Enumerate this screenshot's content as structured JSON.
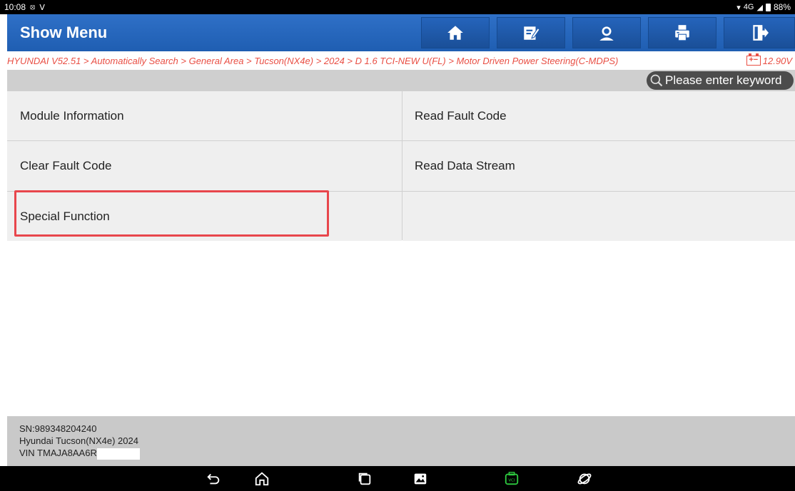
{
  "status_bar": {
    "time": "10:08",
    "battery_percent": "88%",
    "network": "4G"
  },
  "header": {
    "title": "Show Menu",
    "buttons": [
      "home-icon",
      "edit-report-icon",
      "user-icon",
      "print-icon",
      "exit-icon"
    ]
  },
  "breadcrumb": {
    "path": "HYUNDAI V52.51 > Automatically Search > General Area > Tucson(NX4e) > 2024 > D 1.6 TCI-NEW U(FL) > Motor Driven Power Steering(C-MDPS)",
    "voltage": "12.90V"
  },
  "search": {
    "placeholder": "Please enter keyword"
  },
  "menu": {
    "items": [
      "Module Information",
      "Read Fault Code",
      "Clear Fault Code",
      "Read Data Stream",
      "Special Function"
    ]
  },
  "footer": {
    "sn": "SN:989348204240",
    "vehicle": "Hyundai Tucson(NX4e) 2024",
    "vin": "VIN TMAJA8AA6R("
  },
  "colors": {
    "header_blue": "#2f70c7",
    "breadcrumb_red": "#e94f44",
    "highlight_red": "#e8464c",
    "vci_green": "#2ecc40"
  }
}
